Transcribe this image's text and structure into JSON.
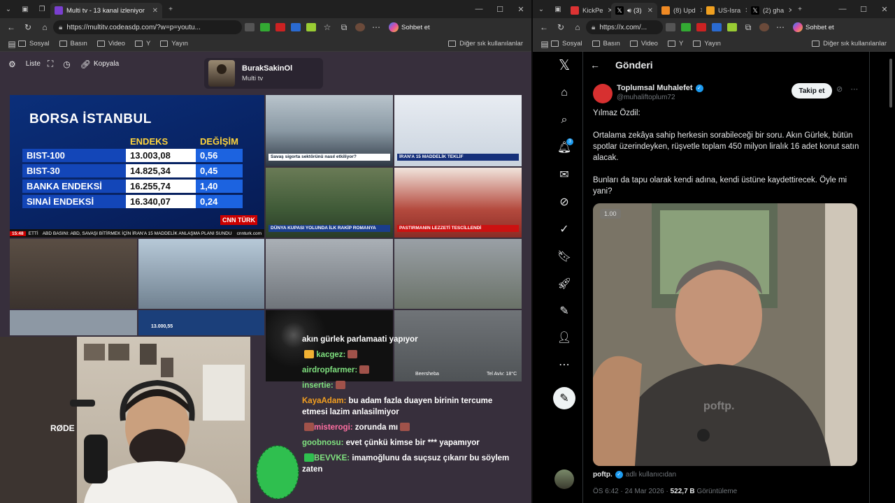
{
  "left": {
    "tabs": [
      {
        "label": "Multi tv - 13 kanal izleniyor"
      }
    ],
    "url": "https://multitv.codeasdp.com/?w=p=youtu...",
    "copilot": "Sohbet et",
    "bookmarks": [
      "Sosyal",
      "Basın",
      "Video",
      "Y",
      "Yayın"
    ],
    "bookmarks_other": "Diğer sık kullanılanlar",
    "toolbar": {
      "list": "Liste",
      "copy": "Kopyala"
    },
    "profile": {
      "name": "BurakSakinOl",
      "sub": "Multi tv"
    },
    "borsa": {
      "title": "BORSA İSTANBUL",
      "headers": {
        "index": "ENDEKS",
        "change": "DEĞİŞİM"
      },
      "rows": [
        {
          "name": "BIST-100",
          "value": "13.003,08",
          "change": "0,56"
        },
        {
          "name": "BIST-30",
          "value": "14.825,34",
          "change": "0,45"
        },
        {
          "name": "BANKA ENDEKSİ",
          "value": "16.255,74",
          "change": "1,40"
        },
        {
          "name": "SINAİ ENDEKSİ",
          "value": "16.340,07",
          "change": "0,24"
        }
      ],
      "logo": "CNN TÜRK",
      "ticker_time": "15:48",
      "ticker_tag": "ETTİ",
      "ticker": "ABD BASINI: ABD, SAVAŞI BİTİRMEK İÇİN İRAN'A 15 MADDELİK ANLAŞMA PLANI SUNDU",
      "site": "cnnturk.com"
    },
    "captions": {
      "t2": "Savaş sigorta sektörünü nasıl etkiliyor?",
      "t3": "İRAN'A 15 MADDELİK TEKLİF",
      "t4": "DÜNYA KUPASI YOLUNDA İLK RAKİP ROMANYA",
      "t5": "PASTIRMANIN LEZZETİ TESCİLLENDİ",
      "t_cam": "Beersheba",
      "t_temp": "Tel Aviv: 18°C",
      "bist_mini": "13.000,55"
    },
    "chat": [
      {
        "user": "",
        "text": "akın gürlek parlamaati yapıyor",
        "color": "w"
      },
      {
        "user": "kacgez:",
        "text": "",
        "color": "g"
      },
      {
        "user": "airdropfarmer:",
        "text": "",
        "color": "g"
      },
      {
        "user": "insertie:",
        "text": "",
        "color": "g"
      },
      {
        "user": "KayaAdam:",
        "text": "bu adam fazla duayen birinin tercume etmesi lazim anlasilmiyor",
        "color": "o"
      },
      {
        "user": "misterogi:",
        "text": "zorunda mı",
        "color": "p"
      },
      {
        "user": "goobnosu:",
        "text": "evet çünkü kimse bir *** yapamıyor",
        "color": "g"
      },
      {
        "user": "BEVVKE:",
        "text": "imamoğlunu da suçsuz çıkarır bu söylem zaten",
        "color": "g"
      }
    ],
    "mic_brand": "RØDE"
  },
  "right": {
    "tabs": [
      {
        "label": "KickPe"
      },
      {
        "label": "(3)"
      },
      {
        "label": "(8) Upd"
      },
      {
        "label": "US-Isra"
      },
      {
        "label": "(2) gha"
      }
    ],
    "url": "https://x.com/...",
    "copilot": "Sohbet et",
    "bookmarks": [
      "Sosyal",
      "Basın",
      "Video",
      "Y",
      "Yayın"
    ],
    "bookmarks_other": "Diğer sık kullanılanlar",
    "header": "Gönderi",
    "notif_count": "3",
    "tweet": {
      "name": "Toplumsal Muhalefet",
      "handle": "@muhaliftoplum72",
      "follow": "Takip et",
      "paragraphs": [
        "Yılmaz Özdil:",
        "Ortalama zekâya sahip herkesin sorabileceği bir soru. Akın Gürlek, bütün spotlar üzerindeyken, rüşvetle toplam 450 milyon liralık 16 adet konut satın alacak.",
        "Bunları da tapu olarak kendi adına, kendi üstüne kaydettirecek. Öyle mi yani?"
      ],
      "speed": "1.00",
      "watermark": "poftp.",
      "source_user": "poftp.",
      "source_note": "adlı kullanıcıdan",
      "time": "ÖS 6:42 · 24 Mar 2026 ·",
      "views": "522,7 B",
      "views_label": "Görüntüleme"
    }
  }
}
